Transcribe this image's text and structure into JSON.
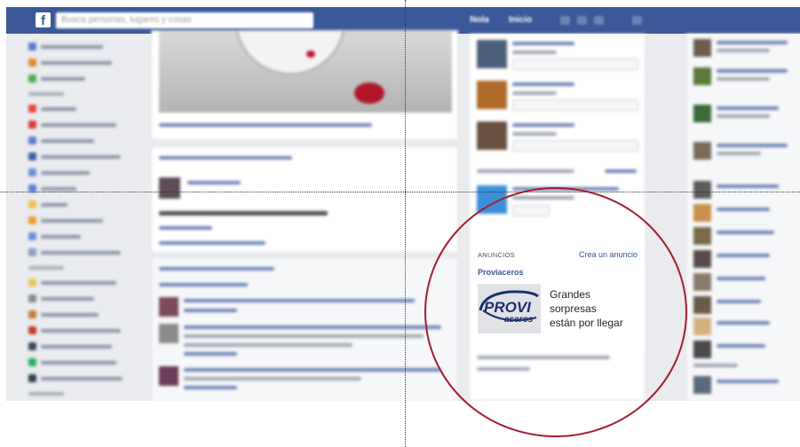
{
  "topbar": {
    "logo": "f",
    "search_placeholder": "Busca personas, lugares y cosas",
    "user_name": "Nola",
    "home_label": "Inicio",
    "bg_color": "#3b5998"
  },
  "ads": {
    "header": "ANUNCIOS",
    "create_link": "Crea un anuncio",
    "sponsor": "Proviaceros",
    "logo_text": "PROVI",
    "logo_subtext": "aceros",
    "body_lines": [
      "Grandes",
      "sorpresas",
      "están por llegar"
    ]
  },
  "annotation": {
    "circle_color": "#a31d2d"
  }
}
